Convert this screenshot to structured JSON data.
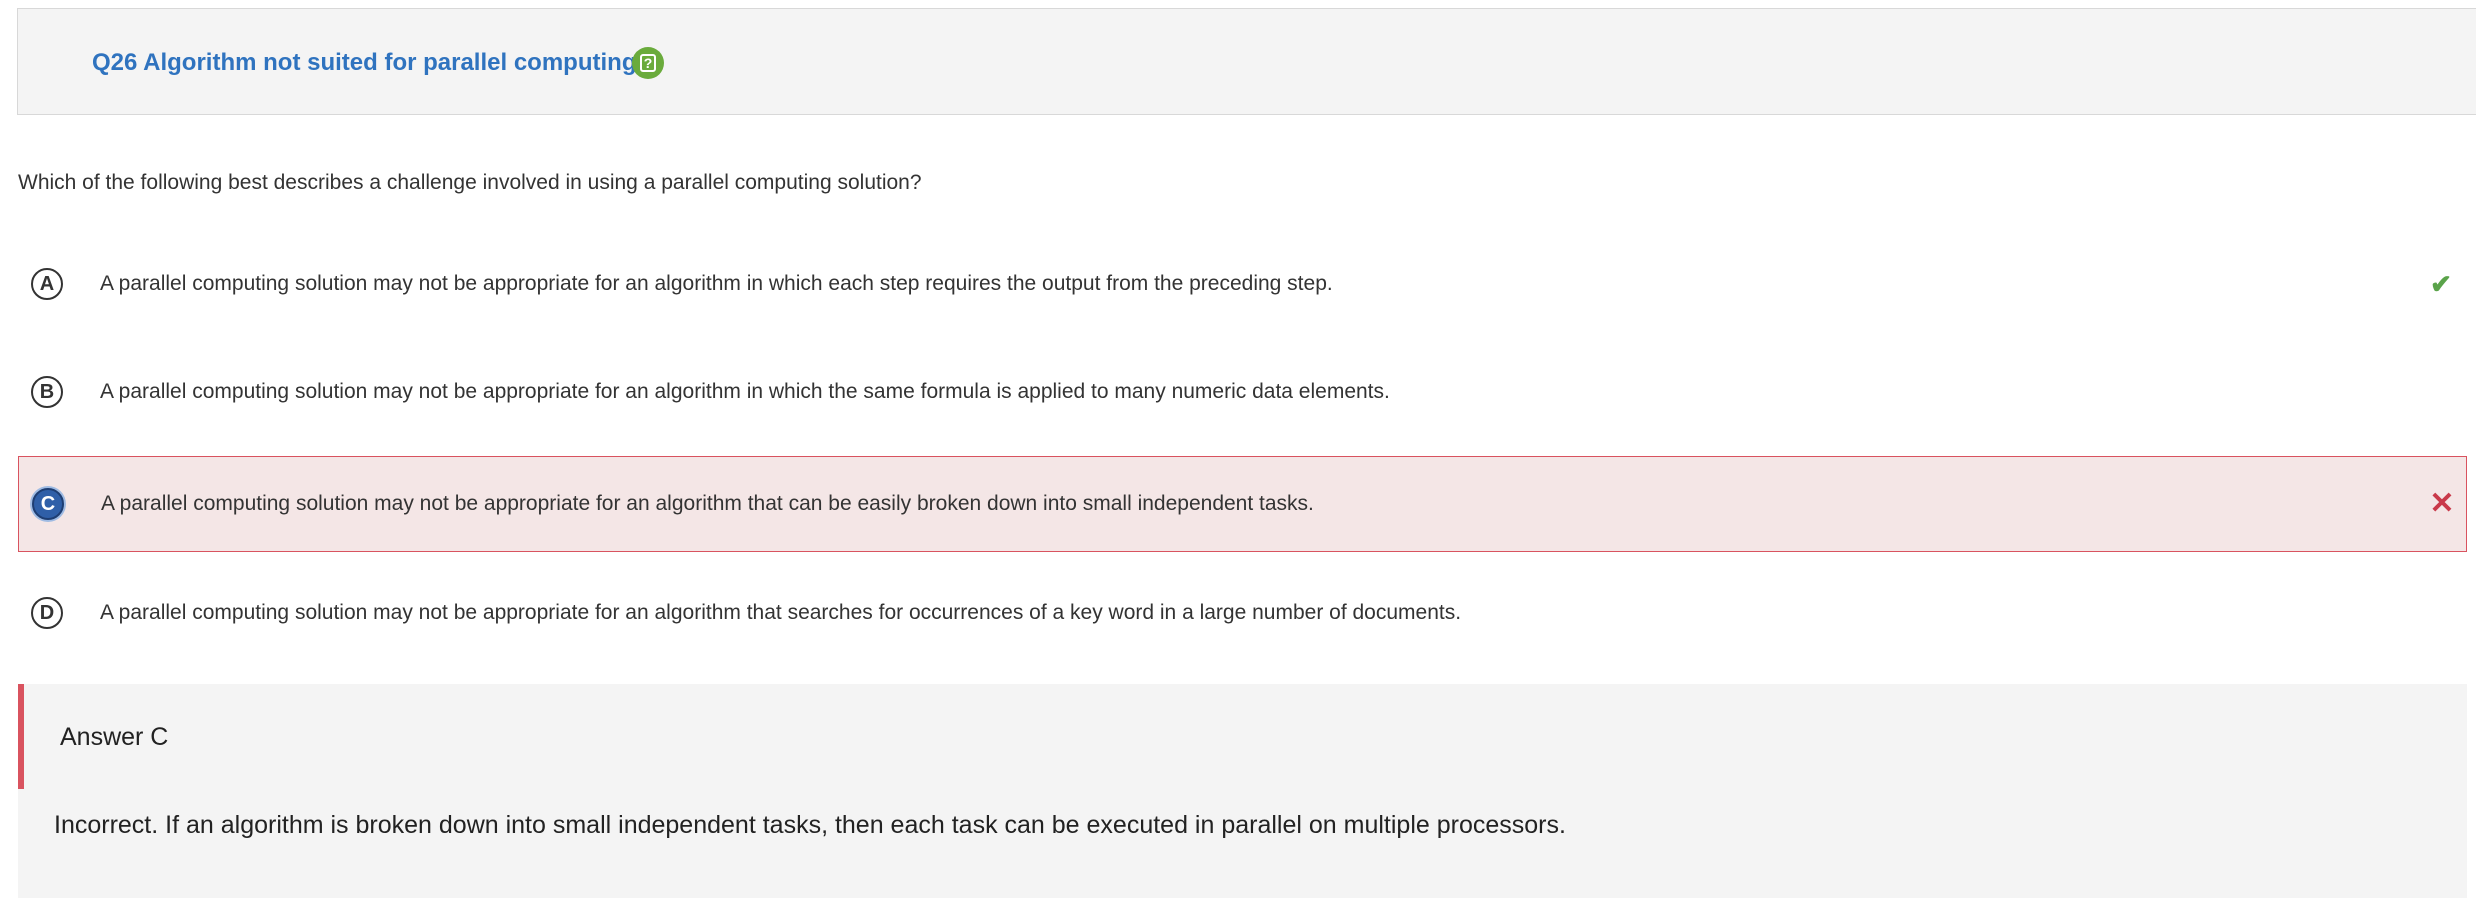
{
  "header": {
    "title": "Q26 Algorithm not suited for parallel computing",
    "help_icon": "help-icon",
    "help_glyph": "?",
    "title_color": "#2f73bf",
    "help_color": "#6aab3c"
  },
  "question": {
    "text": "Which of the following best describes a challenge involved in using a parallel computing solution?"
  },
  "options": [
    {
      "letter": "A",
      "text": "A parallel computing solution may not be appropriate for an algorithm in which each step requires the output from the preceding step.",
      "selected": false,
      "status": "correct",
      "status_icon": "check-icon",
      "status_glyph": "✔"
    },
    {
      "letter": "B",
      "text": "A parallel computing solution may not be appropriate for an algorithm in which the same formula is applied to many numeric data elements.",
      "selected": false,
      "status": "",
      "status_icon": ""
    },
    {
      "letter": "C",
      "text": "A parallel computing solution may not be appropriate for an algorithm that can be easily broken down into small independent tasks.",
      "selected": true,
      "status": "incorrect",
      "status_icon": "close-icon",
      "status_glyph": "✕"
    },
    {
      "letter": "D",
      "text": "A parallel computing solution may not be appropriate for an algorithm that searches for occurrences of a key word in a large number of documents.",
      "selected": false,
      "status": "",
      "status_icon": ""
    }
  ],
  "answer": {
    "heading": "Answer C",
    "explanation": "Incorrect. If an algorithm is broken down into small independent tasks, then each task can be executed in parallel on multiple processors."
  },
  "colors": {
    "correct": "#5aa34a",
    "incorrect": "#c9394a",
    "selected_bg": "#f4e6e6",
    "selected_border": "#d9535f",
    "selected_letter_bg": "#2f5fa8"
  }
}
